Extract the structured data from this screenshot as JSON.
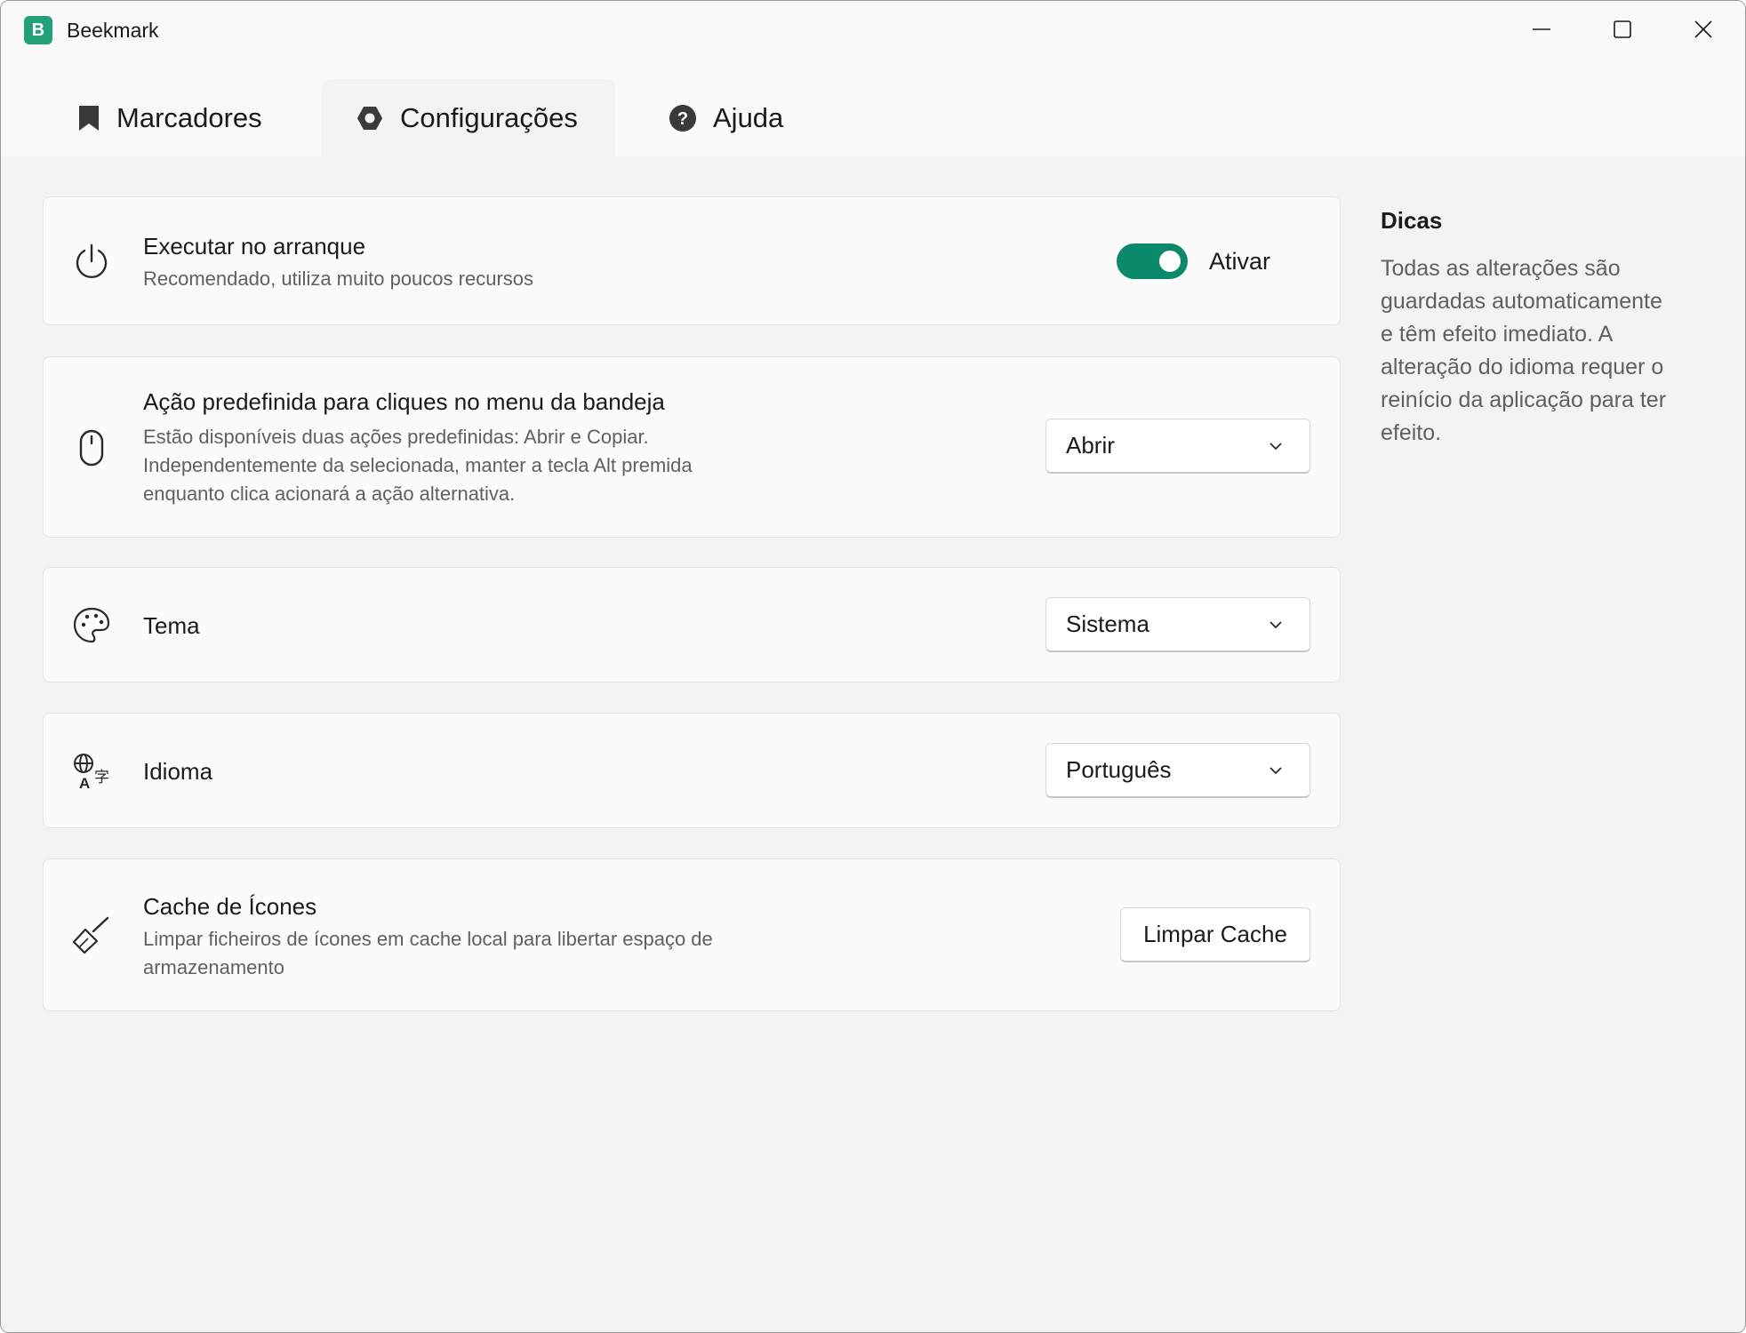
{
  "window": {
    "title": "Beekmark",
    "logo_letter": "B",
    "accent_color": "#0b8a6b"
  },
  "tabs": [
    {
      "label": "Marcadores",
      "icon": "bookmark-icon",
      "active": false
    },
    {
      "label": "Configurações",
      "icon": "gear-icon",
      "active": true
    },
    {
      "label": "Ajuda",
      "icon": "help-icon",
      "active": false
    }
  ],
  "settings": {
    "startup": {
      "title": "Executar no arranque",
      "description": "Recomendado, utiliza muito poucos recursos",
      "toggle_label": "Ativar",
      "toggle_on": true,
      "icon": "power-icon"
    },
    "tray_action": {
      "title": "Ação predefinida para cliques no menu da bandeja",
      "description_lines": [
        "Estão disponíveis duas ações predefinidas: Abrir e Copiar.",
        "Independentemente da selecionada, manter a tecla Alt premida",
        "enquanto clica acionará a ação alternativa."
      ],
      "selected": "Abrir",
      "icon": "mouse-icon"
    },
    "theme": {
      "title": "Tema",
      "selected": "Sistema",
      "icon": "palette-icon"
    },
    "language": {
      "title": "Idioma",
      "selected": "Português",
      "icon": "language-icon"
    },
    "icon_cache": {
      "title": "Cache de Ícones",
      "description_lines": [
        "Limpar ficheiros de ícones em cache local para libertar espaço de",
        "armazenamento"
      ],
      "button_label": "Limpar Cache",
      "icon": "broom-icon"
    }
  },
  "tips": {
    "title": "Dicas",
    "lines": [
      "Todas as alterações são",
      "guardadas automaticamente",
      "e têm efeito imediato. A",
      "alteração do idioma requer o",
      "reinício da aplicação para ter",
      "efeito."
    ]
  }
}
